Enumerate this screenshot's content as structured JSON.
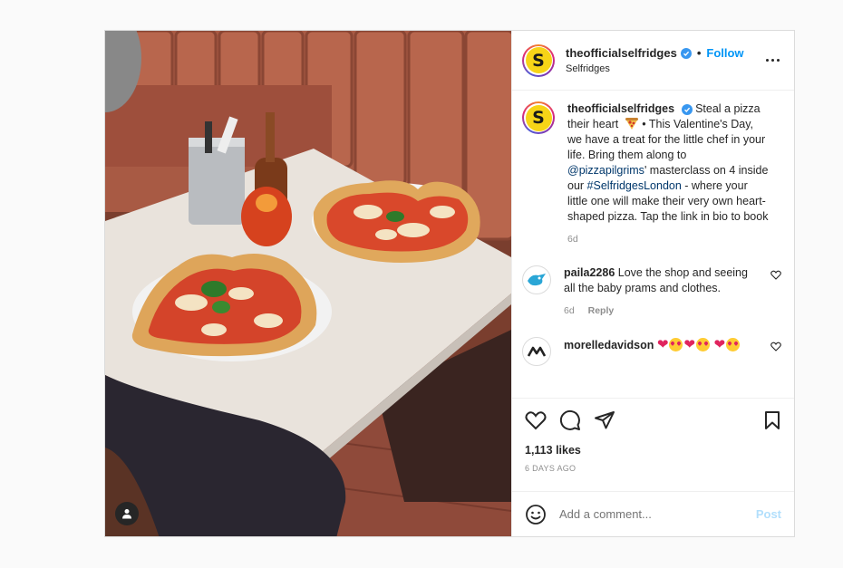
{
  "header": {
    "username": "theofficialselfridges",
    "follow_label": "Follow",
    "display_name": "Selfridges",
    "separator": "•"
  },
  "caption": {
    "username": "theofficialselfridges",
    "text_part1": "Steal a pizza their heart",
    "text_part2": " • This Valentine's Day, we have a treat for the little chef in your life. Bring them along to ",
    "mention": "@pizzapilgrims",
    "text_part3": "' masterclass on 4 inside our ",
    "hashtag": "#SelfridgesLondon",
    "text_part4": " - where your little one will make their very own heart-shaped pizza. Tap the link in bio to book",
    "time": "6d"
  },
  "comments": [
    {
      "username": "paila2286",
      "text": "Love the shop and seeing all the baby prams and clothes.",
      "time": "6d",
      "reply_label": "Reply"
    },
    {
      "username": "morelledavidson",
      "text": ""
    }
  ],
  "likes": "1,113 likes",
  "posted_ago": "6 DAYS AGO",
  "add_comment": {
    "placeholder": "Add a comment...",
    "post_label": "Post"
  },
  "colors": {
    "accent": "#0095f6",
    "verified": "#3897f0",
    "brand_yellow": "#f7d417"
  },
  "icons": [
    "verified-badge-icon",
    "more-options-icon",
    "heart-icon",
    "comment-icon",
    "share-icon",
    "bookmark-icon",
    "emoji-icon",
    "user-tag-icon",
    "pizza-emoji-icon"
  ]
}
